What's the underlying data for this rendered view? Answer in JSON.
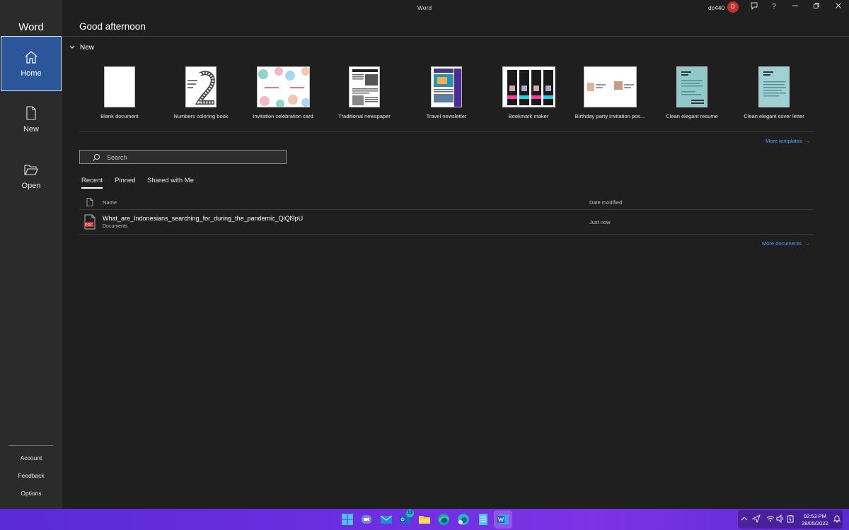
{
  "app": {
    "name": "Word",
    "window_title": "Word",
    "account": "dc440",
    "avatar_initial": "D"
  },
  "sidebar": {
    "items": [
      {
        "label": "Home",
        "icon": "home-icon",
        "active": true
      },
      {
        "label": "New",
        "icon": "new-document-icon",
        "active": false
      },
      {
        "label": "Open",
        "icon": "folder-open-icon",
        "active": false
      }
    ],
    "bottom_links": [
      "Account",
      "Feedback",
      "Options"
    ]
  },
  "main": {
    "greeting": "Good afternoon",
    "new_section_title": "New",
    "templates": [
      {
        "label": "Blank document"
      },
      {
        "label": "Numbers coloring book"
      },
      {
        "label": "Invitation celebration card"
      },
      {
        "label": "Traditional newspaper"
      },
      {
        "label": "Travel newsletter"
      },
      {
        "label": "Bookmark maker"
      },
      {
        "label": "Birthday party invitation pos..."
      },
      {
        "label": "Clean elegant resume"
      },
      {
        "label": "Clean elegant cover letter"
      }
    ],
    "more_templates": "More templates",
    "search_placeholder": "Search",
    "tabs": [
      {
        "label": "Recent",
        "active": true
      },
      {
        "label": "Pinned",
        "active": false
      },
      {
        "label": "Shared with Me",
        "active": false
      }
    ],
    "columns": {
      "name": "Name",
      "date": "Date modified"
    },
    "files": [
      {
        "name": "What_are_Indonesians_searching_for_during_the_pandemic_QiQl9pU",
        "location": "Documents",
        "date": "Just now",
        "icon_label": "PDF"
      }
    ],
    "more_documents": "More documents"
  },
  "taskbar": {
    "teams_badge": "13",
    "time": "02:53 PM",
    "date": "28/05/2022"
  },
  "colors": {
    "accent": "#2b579a",
    "link": "#4aa3ff",
    "avatar": "#c4312d"
  }
}
